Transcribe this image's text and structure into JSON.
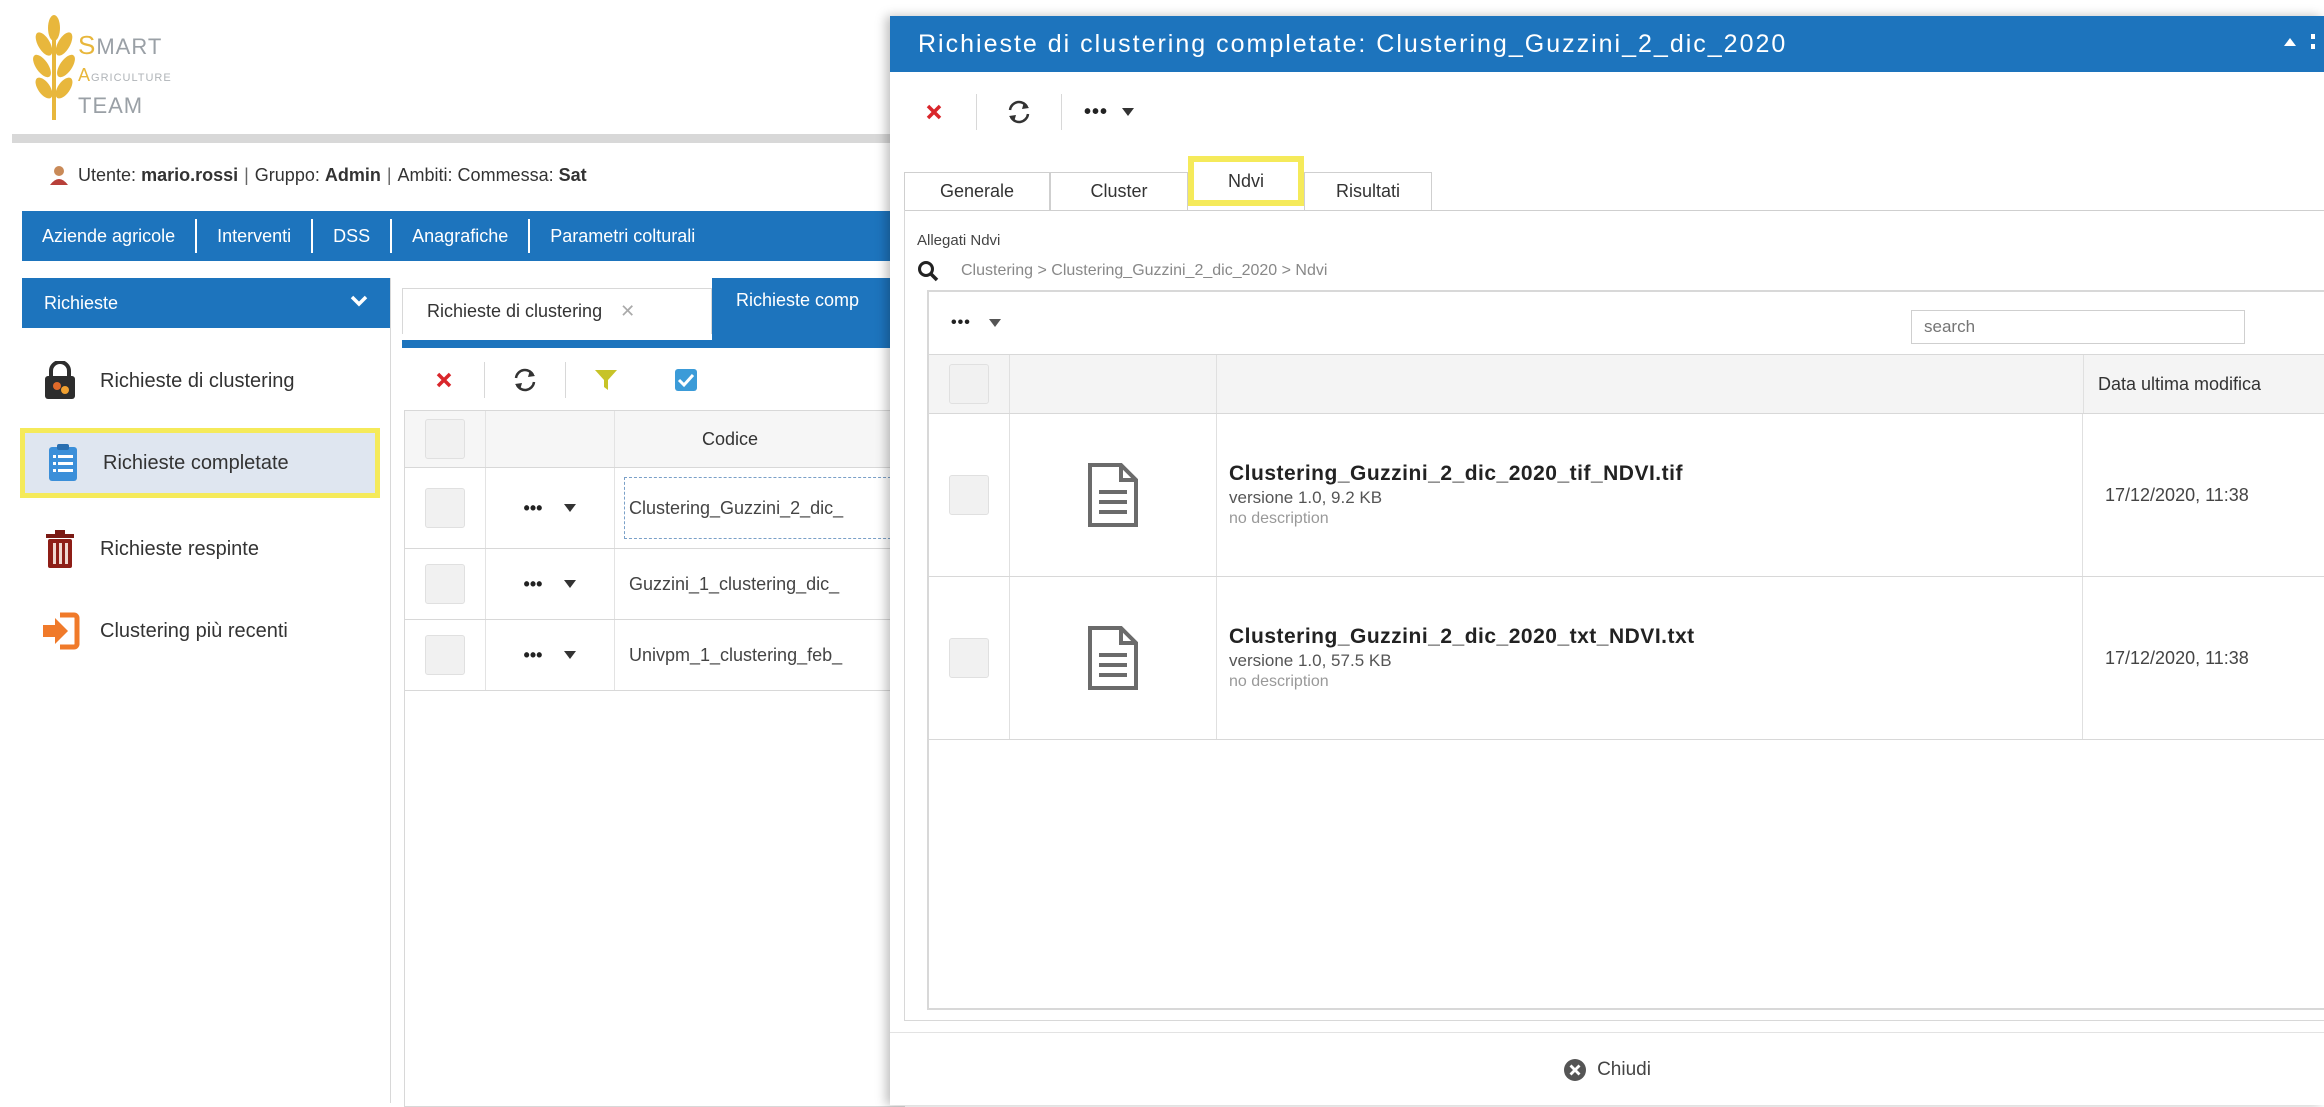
{
  "logo": {
    "line1_cap": "S",
    "line1_rest": "MART",
    "line2_cap": "A",
    "line2_rest": "GRICULTURE",
    "line3": "TEAM"
  },
  "userbar": {
    "user_label": "Utente:",
    "user": "mario.rossi",
    "group_label": "Gruppo:",
    "group": "Admin",
    "scope_label": "Ambiti: Commessa:",
    "scope": "Sat"
  },
  "topnav": [
    "Aziende agricole",
    "Interventi",
    "DSS",
    "Anagrafiche",
    "Parametri colturali"
  ],
  "sidebar": {
    "header": "Richieste",
    "items": [
      {
        "label": "Richieste di clustering",
        "icon": "lock-icon"
      },
      {
        "label": "Richieste completate",
        "icon": "clipboard-list-icon"
      },
      {
        "label": "Richieste respinte",
        "icon": "trash-icon"
      },
      {
        "label": "Clustering più recenti",
        "icon": "sign-in-icon"
      }
    ]
  },
  "mid_tabs": {
    "tab1": "Richieste di clustering",
    "tab2": "Richieste comp"
  },
  "mid_grid": {
    "header_code": "Codice",
    "rows": [
      {
        "code": "Clustering_Guzzini_2_dic_"
      },
      {
        "code": "Guzzini_1_clustering_dic_"
      },
      {
        "code": "Univpm_1_clustering_feb_"
      }
    ]
  },
  "modal": {
    "title": "Richieste di clustering completate: Clustering_Guzzini_2_dic_2020",
    "more_label": "•••",
    "tabs": [
      "Generale",
      "Cluster",
      "Ndvi",
      "Risultati"
    ],
    "active_tab": "Ndvi",
    "attachments_label": "Allegati Ndvi",
    "breadcrumb": "Clustering > Clustering_Guzzini_2_dic_2020 > Ndvi",
    "grid_more_label": "•••",
    "search_placeholder": "search",
    "column_modified": "Data ultima modifica",
    "files": [
      {
        "name": "Clustering_Guzzini_2_dic_2020_tif_NDVI.tif",
        "version": "versione 1.0, 9.2 KB",
        "description": "no description",
        "modified": "17/12/2020, 11:38"
      },
      {
        "name": "Clustering_Guzzini_2_dic_2020_txt_NDVI.txt",
        "version": "versione 1.0, 57.5 KB",
        "description": "no description",
        "modified": "17/12/2020, 11:38"
      }
    ],
    "close_label": "Chiudi"
  },
  "colors": {
    "primary": "#1d74bd",
    "highlight": "#f5ea5a",
    "danger": "#d9262b",
    "filter": "#c7c328",
    "check": "#3b9bd8"
  }
}
